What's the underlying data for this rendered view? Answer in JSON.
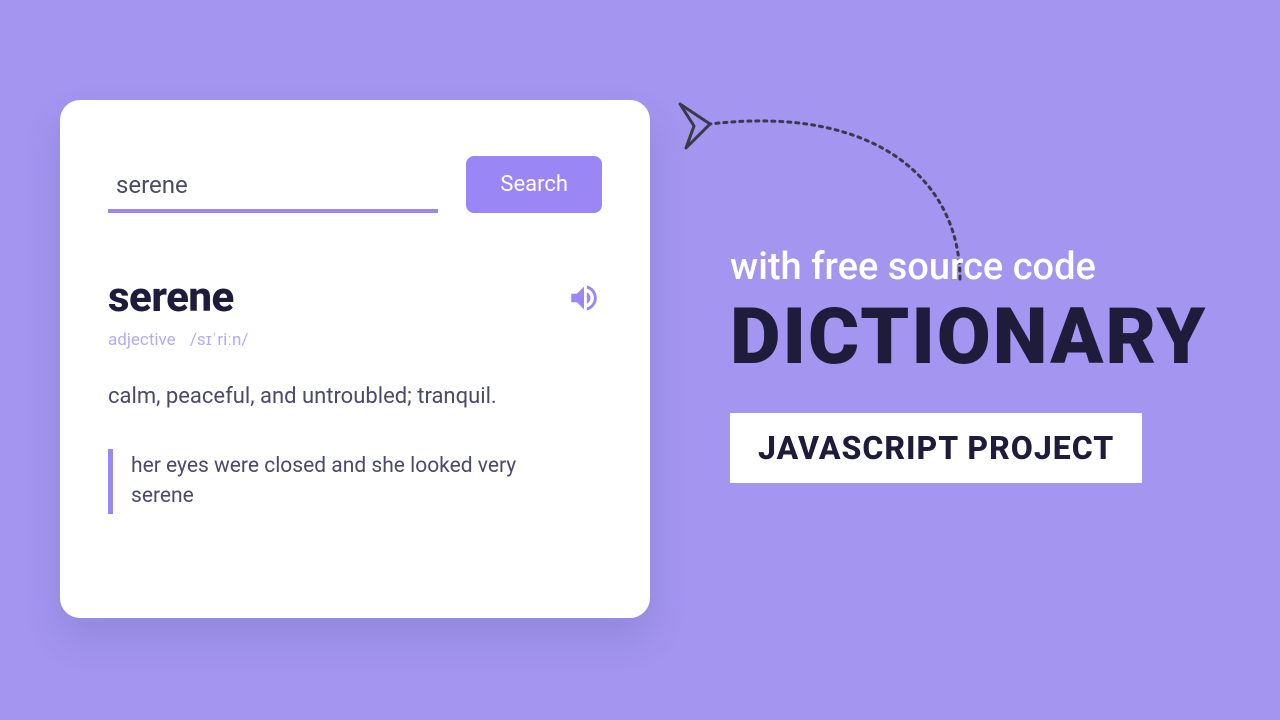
{
  "search": {
    "input_value": "serene",
    "button_label": "Search"
  },
  "result": {
    "word": "serene",
    "part_of_speech": "adjective",
    "pronunciation": "/sɪˈriːn/",
    "definition": "calm, peaceful, and untroubled; tranquil.",
    "example": "her eyes were closed and she looked very serene"
  },
  "promo": {
    "line1": "with free source code",
    "line2": "DICTIONARY",
    "badge": "JAVASCRIPT PROJECT"
  },
  "colors": {
    "background": "#a395f0",
    "accent": "#9a86f4",
    "dark": "#1e1c3a"
  }
}
